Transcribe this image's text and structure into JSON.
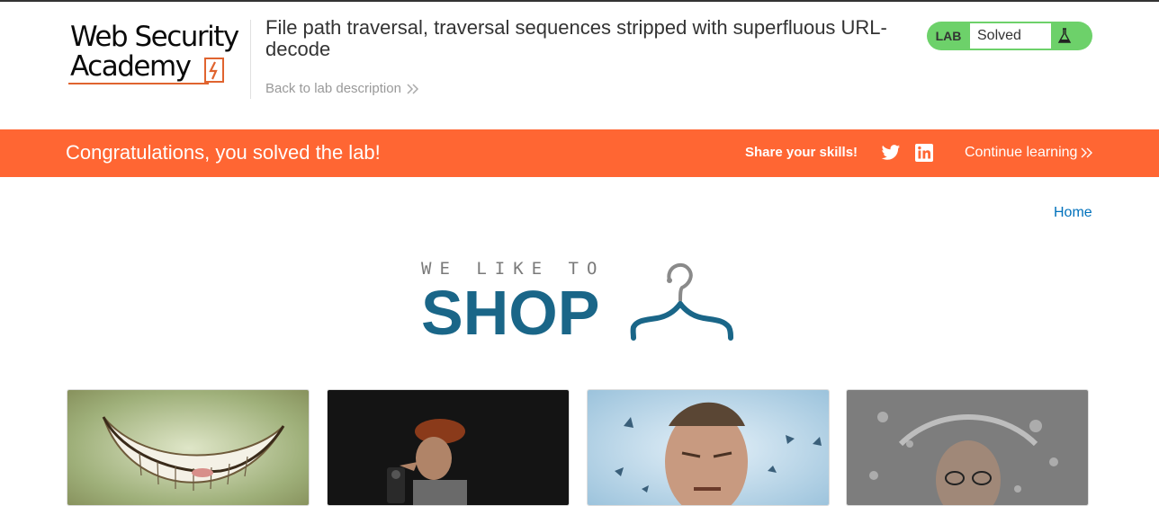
{
  "header": {
    "logo_line1": "Web Security",
    "logo_line2": "Academy",
    "lab_title": "File path traversal, traversal sequences stripped with superfluous URL-decode",
    "back_link": "Back to lab description",
    "lab_tag": "LAB",
    "lab_status": "Solved"
  },
  "notice": {
    "message": "Congratulations, you solved the lab!",
    "share": "Share your skills!",
    "continue": "Continue learning"
  },
  "nav": {
    "home": "Home"
  },
  "shop_logo": {
    "tagline": "WE LIKE TO",
    "word": "SHOP"
  },
  "products": [
    {
      "image": "cheshire-grin"
    },
    {
      "image": "caricature-man-with-camera"
    },
    {
      "image": "man-squinting-blue-background"
    },
    {
      "image": "man-splashed-with-water"
    }
  ],
  "colors": {
    "accent": "#ff6633",
    "solved_green": "#6dd16a",
    "shop_blue": "#1a6688",
    "link_blue": "#0071bc"
  }
}
